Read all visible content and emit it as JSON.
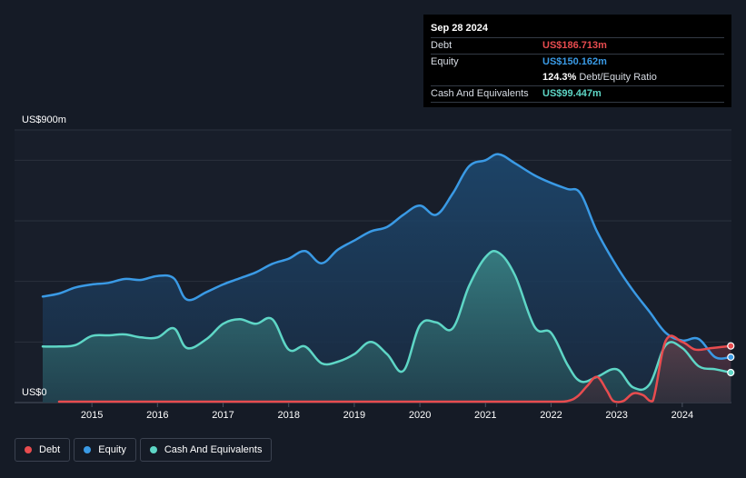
{
  "chart_data": {
    "type": "area",
    "ylabel_top": "US$900m",
    "ylabel_bottom": "US$0",
    "ylim": [
      0,
      900
    ],
    "xlim": [
      2014.25,
      2024.75
    ],
    "grid": true,
    "legend_position": "bottom-left",
    "x_ticks": [
      2015,
      2016,
      2017,
      2018,
      2019,
      2020,
      2021,
      2022,
      2023,
      2024
    ],
    "x_tick_labels": [
      "2015",
      "2016",
      "2017",
      "2018",
      "2019",
      "2020",
      "2021",
      "2022",
      "2023",
      "2024"
    ],
    "series": [
      {
        "name": "Debt",
        "color": "#e84c4f",
        "x": [
          2014.5,
          2015.0,
          2016.0,
          2017.0,
          2018.0,
          2019.0,
          2020.0,
          2021.0,
          2022.0,
          2022.25,
          2022.4,
          2022.55,
          2022.7,
          2022.85,
          2022.95,
          2023.1,
          2023.25,
          2023.4,
          2023.55,
          2023.75,
          2024.0,
          2024.2,
          2024.45,
          2024.74
        ],
        "values": [
          3,
          3,
          3,
          3,
          3,
          3,
          3,
          3,
          3,
          5,
          20,
          55,
          85,
          40,
          5,
          5,
          30,
          25,
          5,
          205,
          200,
          175,
          180,
          187
        ]
      },
      {
        "name": "Equity",
        "color": "#3a9ae5",
        "x": [
          2014.25,
          2014.5,
          2014.75,
          2015.0,
          2015.25,
          2015.5,
          2015.75,
          2016.0,
          2016.25,
          2016.45,
          2016.75,
          2017.0,
          2017.25,
          2017.5,
          2017.75,
          2018.0,
          2018.25,
          2018.5,
          2018.75,
          2019.0,
          2019.25,
          2019.5,
          2019.75,
          2020.0,
          2020.25,
          2020.5,
          2020.75,
          2021.0,
          2021.2,
          2021.45,
          2021.75,
          2022.0,
          2022.25,
          2022.45,
          2022.7,
          2023.0,
          2023.25,
          2023.5,
          2023.75,
          2024.0,
          2024.25,
          2024.5,
          2024.74
        ],
        "values": [
          350,
          360,
          380,
          390,
          395,
          408,
          405,
          418,
          410,
          340,
          365,
          390,
          410,
          430,
          458,
          475,
          500,
          460,
          505,
          535,
          565,
          580,
          620,
          650,
          620,
          690,
          780,
          800,
          820,
          790,
          750,
          725,
          705,
          690,
          565,
          450,
          370,
          300,
          230,
          205,
          210,
          150,
          150
        ]
      },
      {
        "name": "Cash And Equivalents",
        "color": "#5ed6c6",
        "x": [
          2014.25,
          2014.5,
          2014.75,
          2015.0,
          2015.25,
          2015.5,
          2015.75,
          2016.0,
          2016.25,
          2016.45,
          2016.75,
          2017.0,
          2017.25,
          2017.5,
          2017.75,
          2018.0,
          2018.25,
          2018.5,
          2018.75,
          2019.0,
          2019.25,
          2019.5,
          2019.75,
          2020.0,
          2020.25,
          2020.5,
          2020.75,
          2021.0,
          2021.2,
          2021.45,
          2021.75,
          2022.0,
          2022.25,
          2022.45,
          2022.7,
          2023.0,
          2023.25,
          2023.5,
          2023.75,
          2024.0,
          2024.25,
          2024.5,
          2024.74
        ],
        "values": [
          185,
          185,
          190,
          220,
          222,
          225,
          215,
          215,
          245,
          180,
          210,
          260,
          275,
          260,
          275,
          175,
          185,
          130,
          135,
          160,
          200,
          160,
          105,
          255,
          265,
          245,
          385,
          480,
          495,
          420,
          250,
          230,
          125,
          70,
          85,
          110,
          50,
          60,
          190,
          180,
          120,
          110,
          99
        ]
      }
    ]
  },
  "tooltip": {
    "date": "Sep 28 2024",
    "debt_label": "Debt",
    "debt_value": "US$186.713m",
    "equity_label": "Equity",
    "equity_value": "US$150.162m",
    "ratio_value": "124.3%",
    "ratio_text": "Debt/Equity Ratio",
    "cash_label": "Cash And Equivalents",
    "cash_value": "US$99.447m"
  },
  "legend": {
    "items": [
      {
        "label": "Debt",
        "color": "#e84c4f"
      },
      {
        "label": "Equity",
        "color": "#3a9ae5"
      },
      {
        "label": "Cash And Equivalents",
        "color": "#5ed6c6"
      }
    ]
  }
}
